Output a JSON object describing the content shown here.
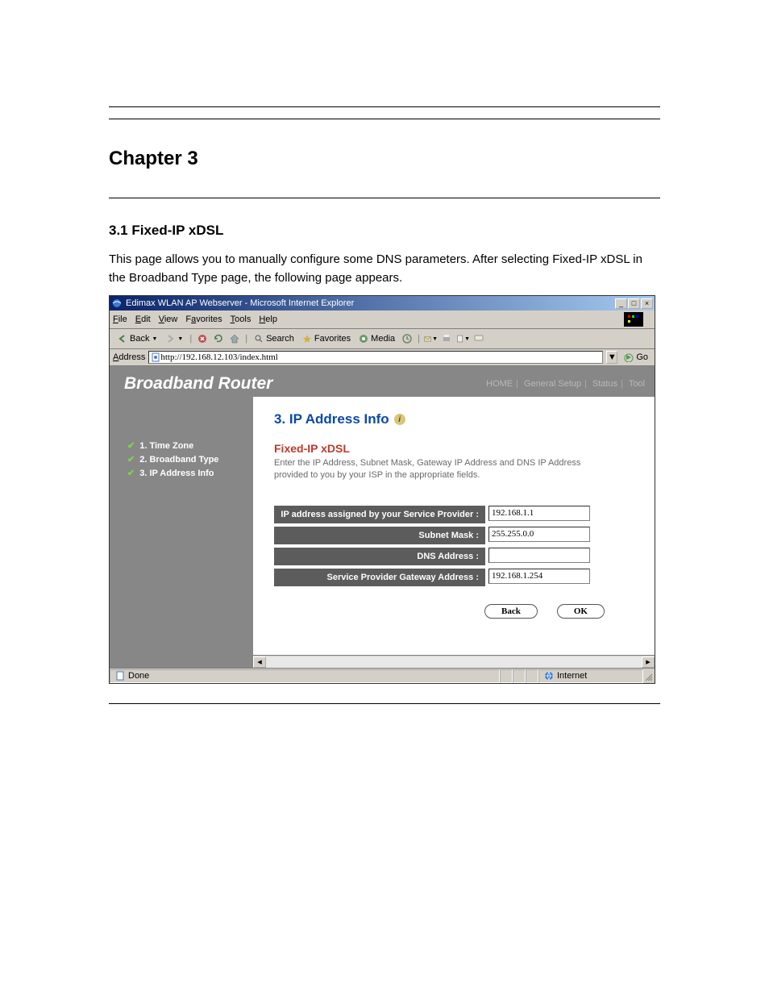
{
  "doc": {
    "n_pages": 1,
    "heading1": "Chapter 3",
    "heading2": "3.1 Fixed-IP xDSL",
    "para1": "This page allows you to manually configure some DNS parameters. After selecting Fixed-IP xDSL in the Broadband Type page, the following page appears."
  },
  "window": {
    "title": "Edimax WLAN AP Webserver - Microsoft Internet Explorer",
    "menus": [
      "File",
      "Edit",
      "View",
      "Favorites",
      "Tools",
      "Help"
    ],
    "toolbar": {
      "back": "Back",
      "search": "Search",
      "favorites": "Favorites",
      "media": "Media"
    },
    "address_label": "Address",
    "address_value": "http://192.168.12.103/index.html",
    "go": "Go",
    "status_left": "Done",
    "status_zone": "Internet"
  },
  "page": {
    "brand": "Broadband Router",
    "toplinks": [
      "HOME",
      "General Setup",
      "Status",
      "Tool"
    ],
    "sidebar": [
      {
        "label": "1. Time Zone"
      },
      {
        "label": "2. Broadband Type"
      },
      {
        "label": "3. IP Address Info"
      }
    ],
    "panel": {
      "title": "3. IP Address Info",
      "subtitle": "Fixed-IP xDSL",
      "desc": "Enter the IP Address, Subnet Mask, Gateway IP Address and DNS IP Address provided to you by your ISP in the appropriate fields.",
      "rows": [
        {
          "label": "IP address assigned by your Service Provider :",
          "value": "192.168.1.1"
        },
        {
          "label": "Subnet Mask :",
          "value": "255.255.0.0"
        },
        {
          "label": "DNS Address :",
          "value": ""
        },
        {
          "label": "Service Provider Gateway Address :",
          "value": "192.168.1.254"
        }
      ],
      "buttons": {
        "back": "Back",
        "ok": "OK"
      }
    }
  }
}
